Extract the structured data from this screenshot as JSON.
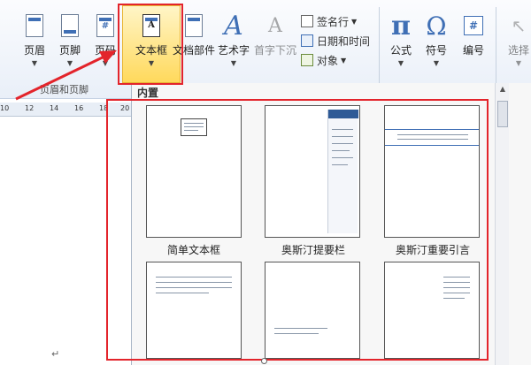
{
  "ribbon": {
    "header": {
      "label": "页眉"
    },
    "footer": {
      "label": "页脚"
    },
    "page_number": {
      "label": "页码",
      "icon_glyph": "#"
    },
    "text_box": {
      "label": "文本框",
      "icon_glyph": "A"
    },
    "doc_parts": {
      "label": "文档部件"
    },
    "word_art": {
      "label": "艺术字",
      "icon_glyph": "A"
    },
    "drop_cap": {
      "label": "首字下沉"
    },
    "signature_line": {
      "label": "签名行"
    },
    "date_time": {
      "label": "日期和时间"
    },
    "object": {
      "label": "对象"
    },
    "equation": {
      "label": "公式",
      "icon_glyph": "π"
    },
    "symbol": {
      "label": "符号",
      "icon_glyph": "Ω"
    },
    "numbering": {
      "label": "编号",
      "icon_glyph": "#"
    },
    "select": {
      "label": "选择"
    },
    "group_header_footer": "页眉和页脚"
  },
  "ruler": {
    "ticks": [
      "10",
      "12",
      "14",
      "16",
      "18",
      "20"
    ]
  },
  "gallery": {
    "section_title": "内置",
    "items": [
      {
        "label": "简单文本框"
      },
      {
        "label": "奥斯汀提要栏"
      },
      {
        "label": "奥斯汀重要引言"
      },
      {
        "label": ""
      },
      {
        "label": ""
      },
      {
        "label": ""
      }
    ]
  },
  "colors": {
    "highlight": "#e3242b",
    "accent": "#3f6fb5",
    "active_button": "#ffd95c"
  }
}
